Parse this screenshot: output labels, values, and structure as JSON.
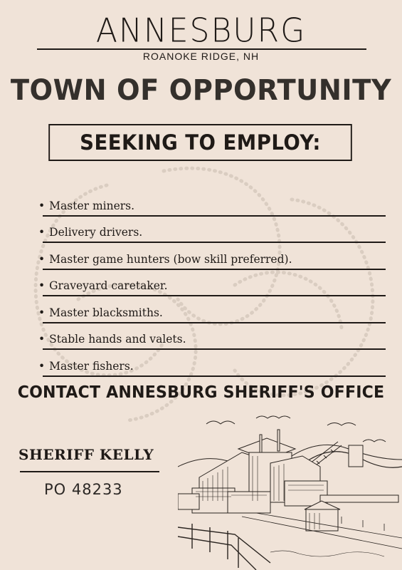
{
  "brand": "ANNESBURG",
  "location": "ROANOKE RIDGE, NH",
  "headline": "TOWN OF OPPORTUNITY",
  "seeking": "SEEKING TO EMPLOY:",
  "jobs": [
    "Master miners.",
    "Delivery drivers.",
    "Master game hunters (bow skill preferred).",
    "Graveyard caretaker.",
    "Master blacksmiths.",
    "Stable hands and valets.",
    "Master fishers."
  ],
  "bullet": "•",
  "contact": "CONTACT ANNESBURG SHERIFF'S OFFICE",
  "sheriff": "SHERIFF KELLY",
  "po_box": "PO 48233",
  "colors": {
    "background": "#f0e3d8",
    "ink": "#1f1a17"
  }
}
